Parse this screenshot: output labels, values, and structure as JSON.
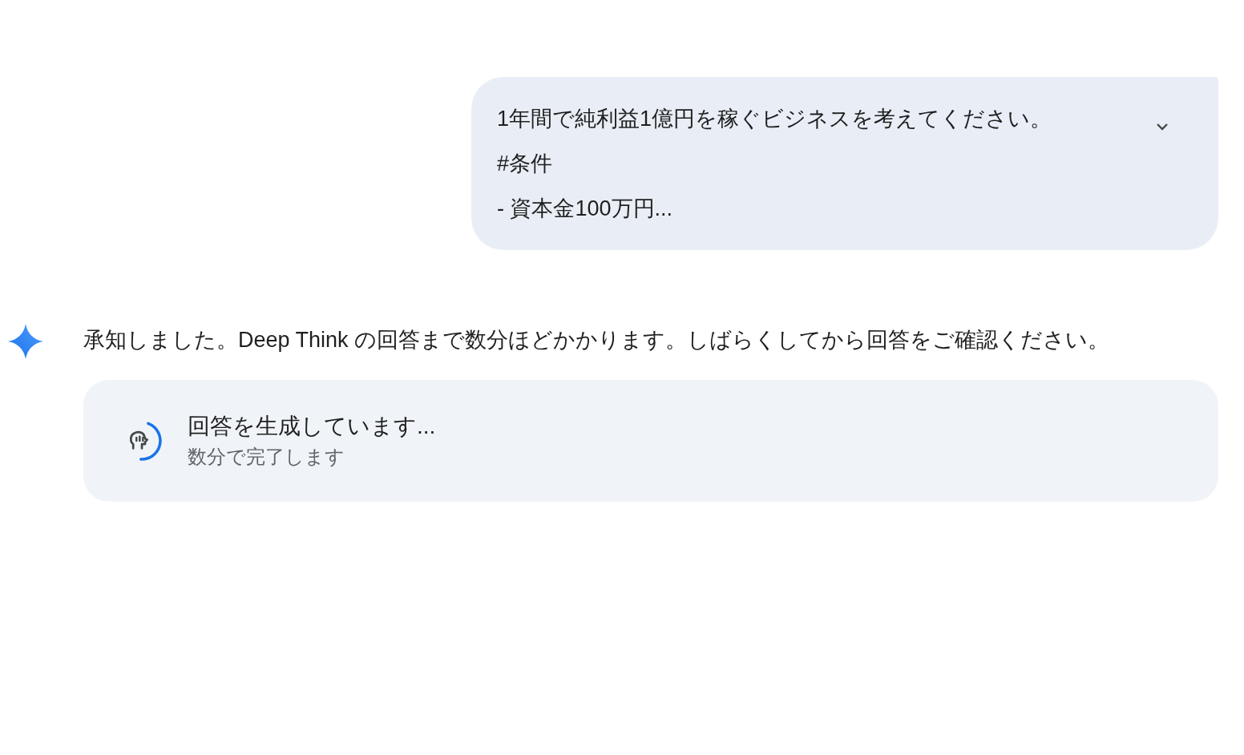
{
  "user_message": {
    "lines": [
      "1年間で純利益1億円を稼ぐビジネスを考えてください。",
      "#条件",
      "- 資本金100万円..."
    ],
    "expanded": false
  },
  "response": {
    "text": "承知しました。Deep Think の回答まで数分ほどかかります。しばらくしてから回答をご確認ください。"
  },
  "status_card": {
    "title": "回答を生成しています...",
    "subtitle": "数分で完了します",
    "level": 0.45
  }
}
